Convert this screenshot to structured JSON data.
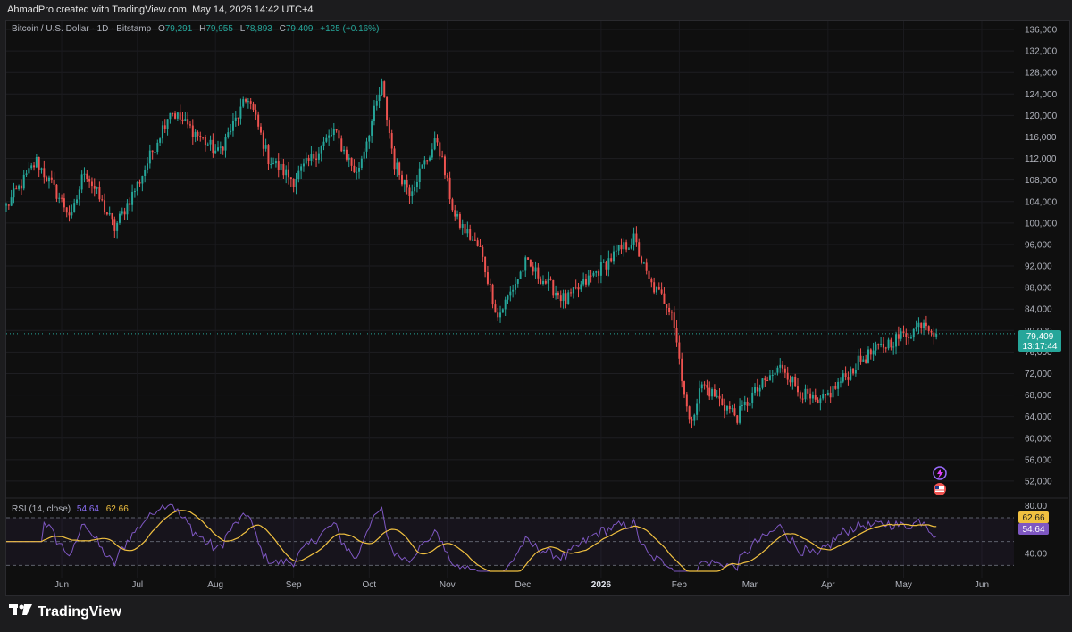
{
  "header": {
    "credit": "AhmadPro created with TradingView.com, May 14, 2026 14:42 UTC+4"
  },
  "legend": {
    "symbol": "Bitcoin / U.S. Dollar · 1D · Bitstamp",
    "open_label": "O",
    "open": "79,291",
    "high_label": "H",
    "high": "79,955",
    "low_label": "L",
    "low": "78,893",
    "close_label": "C",
    "close": "79,409",
    "change": "+125 (+0.16%)"
  },
  "price_tag": {
    "price": "79,409",
    "countdown": "13:17:44"
  },
  "rsi_legend": {
    "label": "RSI (14, close)",
    "value": "54.64",
    "ma_value": "62.66"
  },
  "rsi_tags": {
    "ma": "62.66",
    "rsi": "54.64"
  },
  "brand": {
    "name": "TradingView"
  },
  "colors": {
    "up": "#26a69a",
    "down": "#ef5350",
    "rsi": "#7e57c2",
    "rsi_ma": "#f0c040",
    "background": "#0f0f0f"
  },
  "chart_data": [
    {
      "type": "candlestick",
      "title": "Bitcoin / U.S. Dollar · 1D · Bitstamp",
      "y_axis_ticks": [
        52000,
        56000,
        60000,
        64000,
        68000,
        72000,
        76000,
        80000,
        84000,
        88000,
        92000,
        96000,
        100000,
        104000,
        108000,
        112000,
        116000,
        120000,
        124000,
        128000,
        132000,
        136000
      ],
      "ylim": [
        49000,
        137500
      ],
      "x_axis_labels": [
        "Jun",
        "Jul",
        "Aug",
        "Sep",
        "Oct",
        "Nov",
        "Dec",
        "2026",
        "Feb",
        "Mar",
        "Apr",
        "May",
        "Jun"
      ],
      "xlim": [
        "2025-05-10",
        "2026-06-12"
      ],
      "last_price": 79409,
      "grid": true,
      "anchors": [
        [
          "2025-05-10",
          103000
        ],
        [
          "2025-05-22",
          111500
        ],
        [
          "2025-06-05",
          101000
        ],
        [
          "2025-06-10",
          110000
        ],
        [
          "2025-06-22",
          99000
        ],
        [
          "2025-07-02",
          108000
        ],
        [
          "2025-07-14",
          121000
        ],
        [
          "2025-08-02",
          113000
        ],
        [
          "2025-08-14",
          123500
        ],
        [
          "2025-08-22",
          112000
        ],
        [
          "2025-09-01",
          108000
        ],
        [
          "2025-09-17",
          117000
        ],
        [
          "2025-09-26",
          109000
        ],
        [
          "2025-10-06",
          125500
        ],
        [
          "2025-10-11",
          111000
        ],
        [
          "2025-10-17",
          106000
        ],
        [
          "2025-10-28",
          115500
        ],
        [
          "2025-11-04",
          101000
        ],
        [
          "2025-11-14",
          95000
        ],
        [
          "2025-11-21",
          82500
        ],
        [
          "2025-12-02",
          92500
        ],
        [
          "2025-12-18",
          85500
        ],
        [
          "2026-01-05",
          93500
        ],
        [
          "2026-01-14",
          97000
        ],
        [
          "2026-01-20",
          89000
        ],
        [
          "2026-01-29",
          84000
        ],
        [
          "2026-02-05",
          62500
        ],
        [
          "2026-02-10",
          70000
        ],
        [
          "2026-02-24",
          64000
        ],
        [
          "2026-03-02",
          68000
        ],
        [
          "2026-03-14",
          73500
        ],
        [
          "2026-03-20",
          69000
        ],
        [
          "2026-03-28",
          66000
        ],
        [
          "2026-04-14",
          74500
        ],
        [
          "2026-04-26",
          78000
        ],
        [
          "2026-05-05",
          80000
        ],
        [
          "2026-05-09",
          82000
        ],
        [
          "2026-05-14",
          79409
        ]
      ]
    },
    {
      "type": "line",
      "title": "RSI (14, close)",
      "y_axis_ticks": [
        40,
        80
      ],
      "levels": [
        30,
        50,
        70
      ],
      "ylim": [
        25,
        85
      ],
      "series": [
        {
          "name": "RSI",
          "last": 54.64
        },
        {
          "name": "RSI-based MA",
          "last": 62.66
        }
      ]
    }
  ]
}
